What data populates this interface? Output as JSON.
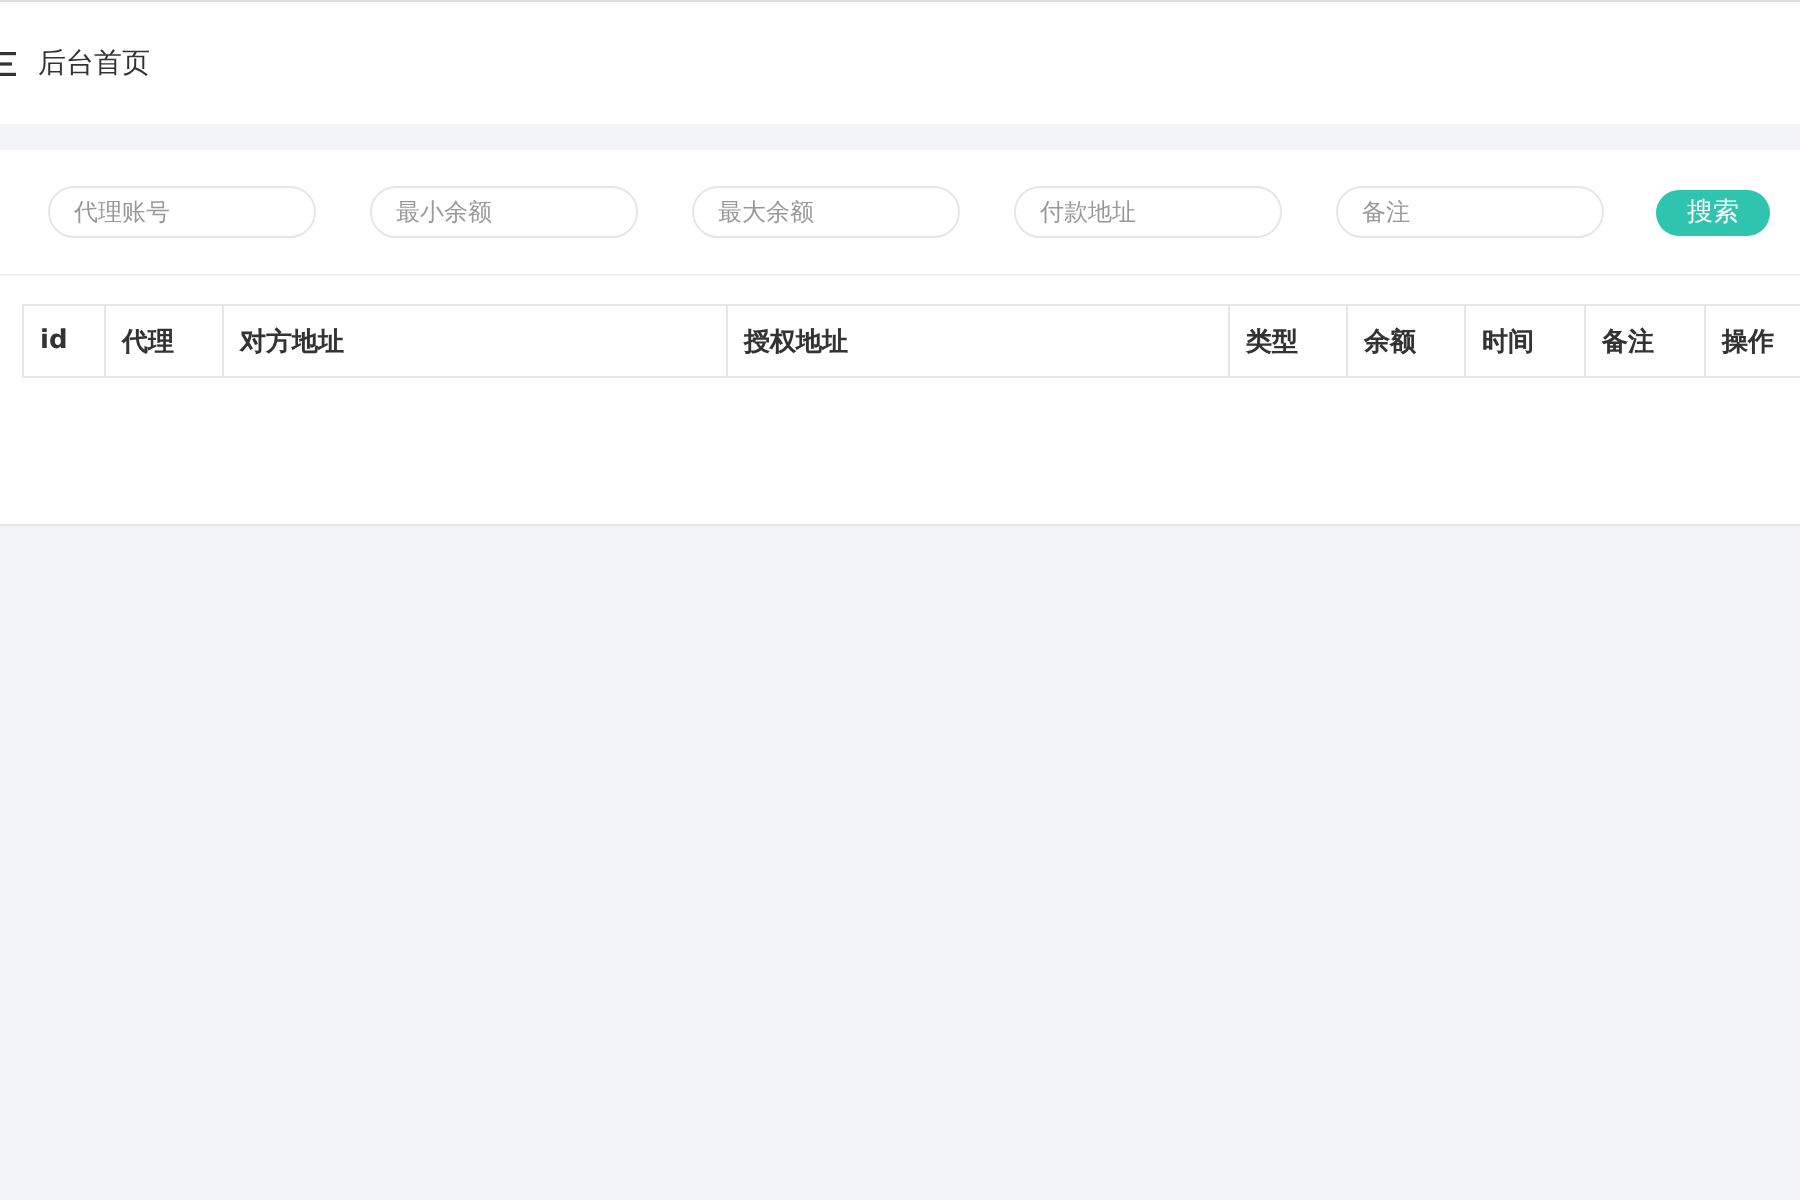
{
  "header": {
    "title": "后台首页"
  },
  "filters": [
    {
      "placeholder": "代理账号"
    },
    {
      "placeholder": "最小余额"
    },
    {
      "placeholder": "最大余额"
    },
    {
      "placeholder": "付款地址"
    },
    {
      "placeholder": "备注"
    }
  ],
  "search_button": "搜索",
  "table": {
    "columns": [
      "id",
      "代理",
      "对方地址",
      "授权地址",
      "类型",
      "余额",
      "时间",
      "备注",
      "操作"
    ]
  }
}
